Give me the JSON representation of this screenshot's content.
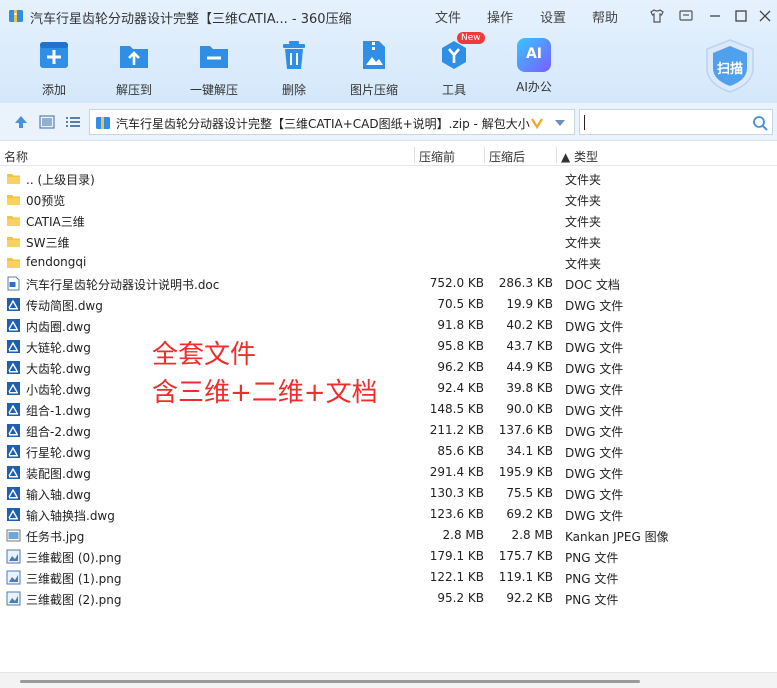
{
  "window": {
    "title": "汽车行星齿轮分动器设计完整【三维CATIA... - 360压缩",
    "menu": [
      "文件",
      "操作",
      "设置",
      "帮助"
    ]
  },
  "toolbar": {
    "items": [
      {
        "label": "添加",
        "icon": "add-icon"
      },
      {
        "label": "解压到",
        "icon": "extract-to-icon"
      },
      {
        "label": "一键解压",
        "icon": "one-click-extract-icon"
      },
      {
        "label": "删除",
        "icon": "delete-icon"
      },
      {
        "label": "图片压缩",
        "icon": "image-compress-icon"
      },
      {
        "label": "工具",
        "icon": "tools-icon",
        "badge": "New"
      },
      {
        "label": "AI办公",
        "icon": "ai-office-icon",
        "icon_text": "AI"
      }
    ],
    "scan_label": "扫描"
  },
  "address": {
    "path": "汽车行星齿轮分动器设计完整【三维CATIA+CAD图纸+说明】.zip - 解包大小",
    "search_value": ""
  },
  "columns": {
    "name": "名称",
    "packed": "压缩前",
    "compressed": "压缩后",
    "type": "▲ 类型"
  },
  "files": [
    {
      "name": ".. (上级目录)",
      "packed": "",
      "compressed": "",
      "type": "文件夹",
      "kind": "folder"
    },
    {
      "name": "00预览",
      "packed": "",
      "compressed": "",
      "type": "文件夹",
      "kind": "folder"
    },
    {
      "name": "CATIA三维",
      "packed": "",
      "compressed": "",
      "type": "文件夹",
      "kind": "folder"
    },
    {
      "name": "SW三维",
      "packed": "",
      "compressed": "",
      "type": "文件夹",
      "kind": "folder"
    },
    {
      "name": "fendongqi",
      "packed": "",
      "compressed": "",
      "type": "文件夹",
      "kind": "folder"
    },
    {
      "name": "汽车行星齿轮分动器设计说明书.doc",
      "packed": "752.0 KB",
      "compressed": "286.3 KB",
      "type": "DOC 文档",
      "kind": "doc"
    },
    {
      "name": "传动简图.dwg",
      "packed": "70.5 KB",
      "compressed": "19.9 KB",
      "type": "DWG 文件",
      "kind": "dwg"
    },
    {
      "name": "内齿圈.dwg",
      "packed": "91.8 KB",
      "compressed": "40.2 KB",
      "type": "DWG 文件",
      "kind": "dwg"
    },
    {
      "name": "大链轮.dwg",
      "packed": "95.8 KB",
      "compressed": "43.7 KB",
      "type": "DWG 文件",
      "kind": "dwg"
    },
    {
      "name": "大齿轮.dwg",
      "packed": "96.2 KB",
      "compressed": "44.9 KB",
      "type": "DWG 文件",
      "kind": "dwg"
    },
    {
      "name": "小齿轮.dwg",
      "packed": "92.4 KB",
      "compressed": "39.8 KB",
      "type": "DWG 文件",
      "kind": "dwg"
    },
    {
      "name": "组合-1.dwg",
      "packed": "148.5 KB",
      "compressed": "90.0 KB",
      "type": "DWG 文件",
      "kind": "dwg"
    },
    {
      "name": "组合-2.dwg",
      "packed": "211.2 KB",
      "compressed": "137.6 KB",
      "type": "DWG 文件",
      "kind": "dwg"
    },
    {
      "name": "行星轮.dwg",
      "packed": "85.6 KB",
      "compressed": "34.1 KB",
      "type": "DWG 文件",
      "kind": "dwg"
    },
    {
      "name": "装配图.dwg",
      "packed": "291.4 KB",
      "compressed": "195.9 KB",
      "type": "DWG 文件",
      "kind": "dwg"
    },
    {
      "name": "输入轴.dwg",
      "packed": "130.3 KB",
      "compressed": "75.5 KB",
      "type": "DWG 文件",
      "kind": "dwg"
    },
    {
      "name": "输入轴换挡.dwg",
      "packed": "123.6 KB",
      "compressed": "69.2 KB",
      "type": "DWG 文件",
      "kind": "dwg"
    },
    {
      "name": "任务书.jpg",
      "packed": "2.8 MB",
      "compressed": "2.8 MB",
      "type": "Kankan JPEG 图像",
      "kind": "jpg"
    },
    {
      "name": "三维截图 (0).png",
      "packed": "179.1 KB",
      "compressed": "175.7 KB",
      "type": "PNG 文件",
      "kind": "png"
    },
    {
      "name": "三维截图 (1).png",
      "packed": "122.1 KB",
      "compressed": "119.1 KB",
      "type": "PNG 文件",
      "kind": "png"
    },
    {
      "name": "三维截图 (2).png",
      "packed": "95.2 KB",
      "compressed": "92.2 KB",
      "type": "PNG 文件",
      "kind": "png"
    }
  ],
  "overlay": {
    "line1": "全套文件",
    "line2": "含三维+二维+文档",
    "color": "#ef2d2d"
  },
  "colors": {
    "accent": "#2f8ee5",
    "folder": "#f5c342",
    "toolbar_bg": "#e1eefc"
  }
}
